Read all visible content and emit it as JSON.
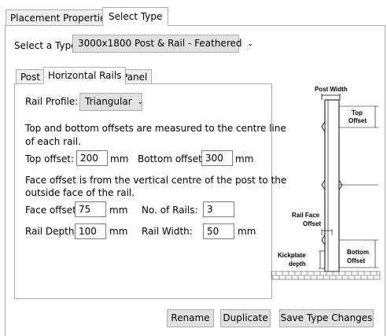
{
  "top_tabs": [
    {
      "label": "Placement Properties"
    },
    {
      "label": "Select Type"
    }
  ],
  "type_select": {
    "label": "Select a Type:",
    "value": "3000x1800 Post & Rail - Feathered"
  },
  "inner_tabs": [
    {
      "label": "Post"
    },
    {
      "label": "Horizontal Rails"
    },
    {
      "label": "Panel"
    }
  ],
  "rails": {
    "profile_label": "Rail Profile:",
    "profile_value": "Triangular",
    "offset_note_1": "Top and bottom offsets are measured to the centre line",
    "offset_note_2": "of each rail.",
    "top_offset_label": "Top offset:",
    "top_offset_value": "200",
    "top_offset_unit": "mm",
    "bottom_offset_label": "Bottom offset:",
    "bottom_offset_value": "300",
    "bottom_offset_unit": "mm",
    "face_note_1": "Face offset is from the vertical centre of the post to the",
    "face_note_2": "outside face of the rail.",
    "face_offset_label": "Face offset:",
    "face_offset_value": "75",
    "face_offset_unit": "mm",
    "num_rails_label": "No. of Rails:",
    "num_rails_value": "3",
    "rail_depth_label": "Rail Depth:",
    "rail_depth_value": "100",
    "rail_depth_unit": "mm",
    "rail_width_label": "Rail Width:",
    "rail_width_value": "50",
    "rail_width_unit": "mm"
  },
  "diagram": {
    "post_width": "Post Width",
    "top_offset_1": "Top",
    "top_offset_2": "Offset",
    "rail_face_1": "Rail Face",
    "rail_face_2": "Offset",
    "bottom_offset_1": "Bottom",
    "bottom_offset_2": "Offset",
    "kickplate_1": "Kickplate",
    "kickplate_2": "depth"
  },
  "buttons": {
    "rename": "Rename",
    "duplicate": "Duplicate",
    "save": "Save Type Changes"
  },
  "icons": {
    "dropdown": "chevron-down-icon"
  }
}
